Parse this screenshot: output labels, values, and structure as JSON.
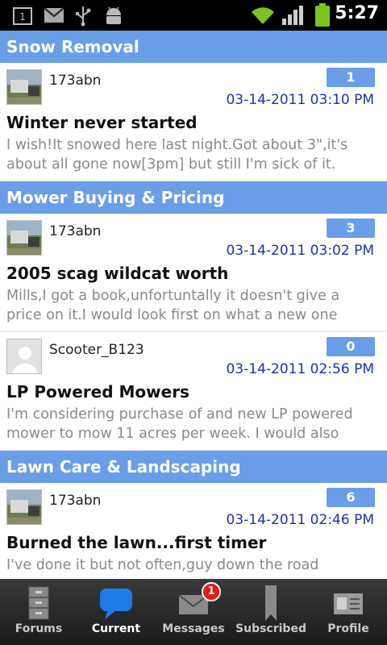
{
  "status_bar": {
    "sim_label": "1",
    "time": "5:27",
    "icons": [
      "sim-icon",
      "gmail-icon",
      "usb-icon",
      "android-debug-icon",
      "wifi-icon",
      "signal-icon",
      "battery-icon"
    ]
  },
  "sections": [
    {
      "title": "Snow Removal",
      "items": [
        {
          "username": "173abn",
          "avatar": "photo",
          "count": "1",
          "date": "03-14-2011 03:10 PM",
          "title": "Winter never started",
          "preview": "I wish!It snowed here last night.Got about 3\",it's about all gone now[3pm] but still I'm sick of it."
        }
      ]
    },
    {
      "title": "Mower Buying & Pricing",
      "items": [
        {
          "username": "173abn",
          "avatar": "photo",
          "count": "3",
          "date": "03-14-2011 03:02 PM",
          "title": "2005 scag wildcat worth",
          "preview": "Mills,I got a book,unfortuntally it doesn't give a price on it.I would look first on what a new one"
        },
        {
          "username": "Scooter_B123",
          "avatar": "default",
          "count": "0",
          "date": "03-14-2011 02:56 PM",
          "title": "LP Powered Mowers",
          "preview": "I'm considering purchase of and new LP powered mower to mow 11 acres per week. I would also"
        }
      ]
    },
    {
      "title": "Lawn Care & Landscaping",
      "items": [
        {
          "username": "173abn",
          "avatar": "photo",
          "count": "6",
          "date": "03-14-2011 02:46 PM",
          "title": "Burned the lawn...first timer",
          "preview": "I've done it but not often,guy down the road"
        }
      ]
    }
  ],
  "tabs": [
    {
      "label": "Forums",
      "icon": "cabinet-icon",
      "active": false
    },
    {
      "label": "Current",
      "icon": "speech-bubble-icon",
      "active": true
    },
    {
      "label": "Messages",
      "icon": "envelope-icon",
      "active": false,
      "badge": "1"
    },
    {
      "label": "Subscribed",
      "icon": "bookmark-icon",
      "active": false
    },
    {
      "label": "Profile",
      "icon": "id-card-icon",
      "active": false
    }
  ],
  "colors": {
    "section_header": "#6a9ee8",
    "badge": "#6a9ee8",
    "date_text": "#1e33a8",
    "notification": "#e01b1b"
  }
}
